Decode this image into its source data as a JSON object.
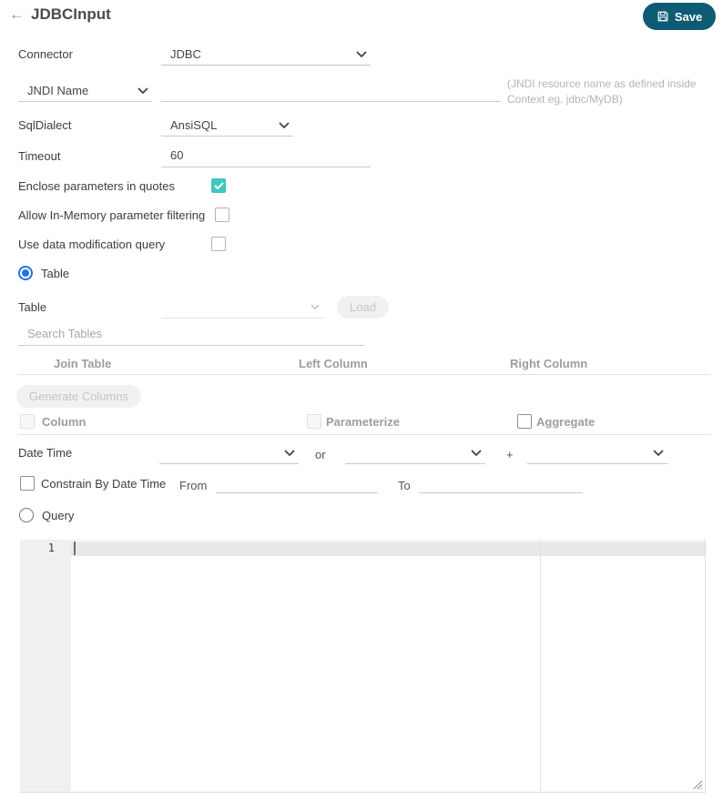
{
  "header": {
    "back_icon": "←",
    "title": "JDBCInput",
    "save_label": "Save",
    "save_icon": "floppy-disk"
  },
  "colors": {
    "save_button": "#0d5c74",
    "checkbox_checked": "#41c5c3",
    "radio_selected": "#2374e1"
  },
  "connector": {
    "label": "Connector",
    "value": "JDBC"
  },
  "jndi": {
    "selector_value": "JNDI Name",
    "input_value": "",
    "hint": "(JNDI resource name as defined inside Context eg. jdbc/MyDB)"
  },
  "sql_dialect": {
    "label": "SqlDialect",
    "value": "AnsiSQL"
  },
  "timeout": {
    "label": "Timeout",
    "value": "60"
  },
  "options": {
    "enclose_quotes": {
      "label": "Enclose parameters in quotes",
      "checked": true
    },
    "in_memory_filtering": {
      "label": "Allow In-Memory parameter filtering",
      "checked": false
    },
    "data_modification": {
      "label": "Use data modification query",
      "checked": false
    }
  },
  "table_section": {
    "radio_label": "Table",
    "radio_selected": true,
    "table_field": {
      "label": "Table",
      "value": "",
      "load_label": "Load",
      "disabled": true
    },
    "search_placeholder": "Search Tables",
    "join_columns": [
      "Join Table",
      "Left Column",
      "Right Column"
    ],
    "generate_columns_label": "Generate Columns",
    "column_checkboxes": [
      {
        "label": "Column",
        "checked": false,
        "disabled": true
      },
      {
        "label": "Parameterize",
        "checked": false,
        "disabled": true
      },
      {
        "label": "Aggregate",
        "checked": false,
        "disabled": false
      }
    ],
    "datetime_row": {
      "label": "Date Time",
      "value1": "",
      "or_label": "or",
      "value2": "",
      "plus_label": "+",
      "value3": ""
    },
    "constrain_row": {
      "label": "Constrain By Date Time",
      "checked": false,
      "from_label": "From",
      "from_value": "",
      "to_label": "To",
      "to_value": ""
    }
  },
  "query_section": {
    "radio_label": "Query",
    "radio_selected": false,
    "editor": {
      "line_number": "1",
      "content": ""
    }
  }
}
